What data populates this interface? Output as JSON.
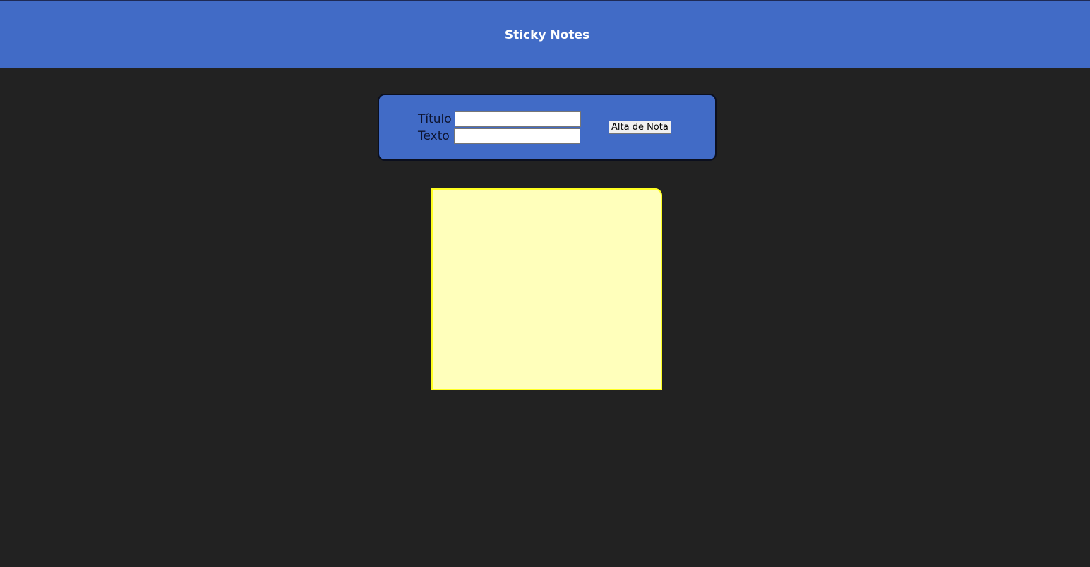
{
  "header": {
    "title": "Sticky Notes",
    "background_color": "#416bc6"
  },
  "form": {
    "title_label": "Título",
    "title_value": "",
    "text_label": "Texto",
    "text_value": "",
    "submit_label": "Alta de Nota"
  },
  "notes": [
    {
      "title": "",
      "text": "",
      "background_color": "#ffffbb",
      "border_color": "#ffff22"
    }
  ],
  "colors": {
    "page_background": "#222222",
    "accent": "#416bc6"
  }
}
